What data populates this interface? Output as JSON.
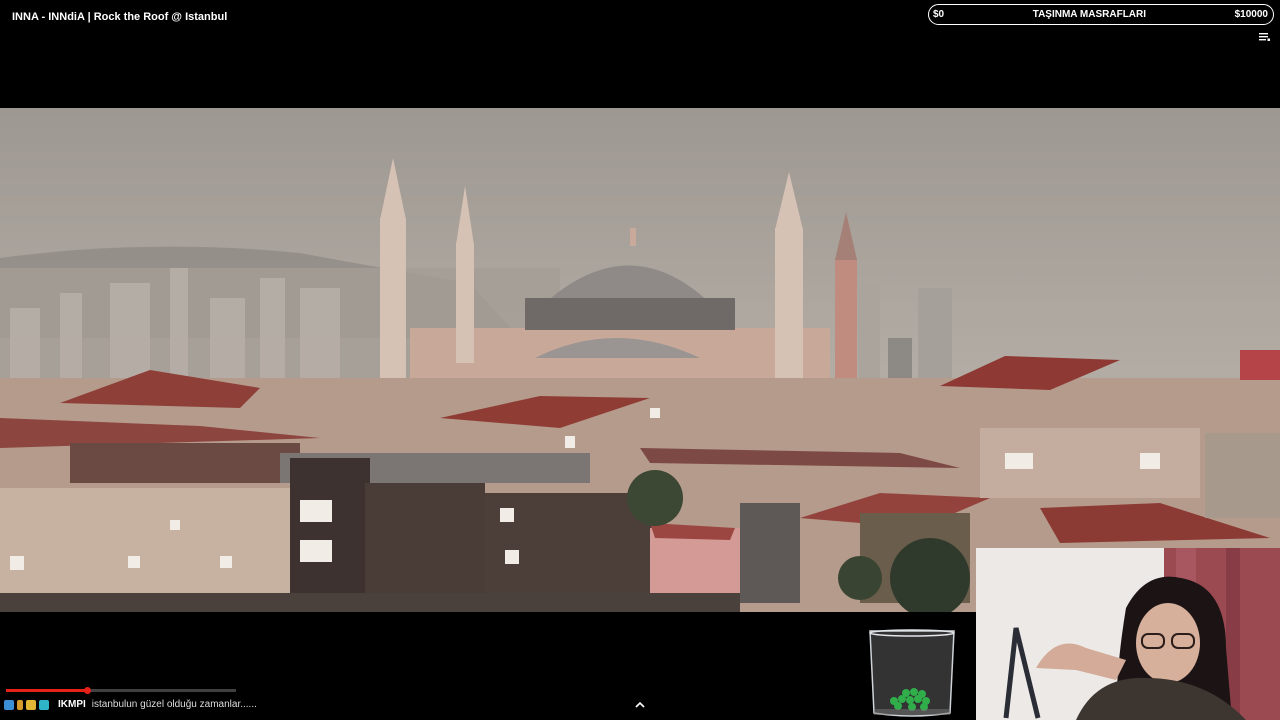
{
  "video": {
    "title": "INNA - INNdiA | Rock the Roof @ Istanbul",
    "progress": 0.35
  },
  "goal": {
    "label": "TAŞINMA MASRAFLARI",
    "min": "$0",
    "max": "$10000",
    "progress": 0.0
  },
  "ticker": {
    "user": "IKMPI",
    "message": "istanbulun güzel olduğu zamanlar......"
  },
  "colors": {
    "goal_border": "#ffffff",
    "progress": "#e62117",
    "sky": "#a9a39c"
  },
  "icons": [
    "menu-icon",
    "chevron-up-icon",
    "emote-icon",
    "tip-jar-icon"
  ]
}
